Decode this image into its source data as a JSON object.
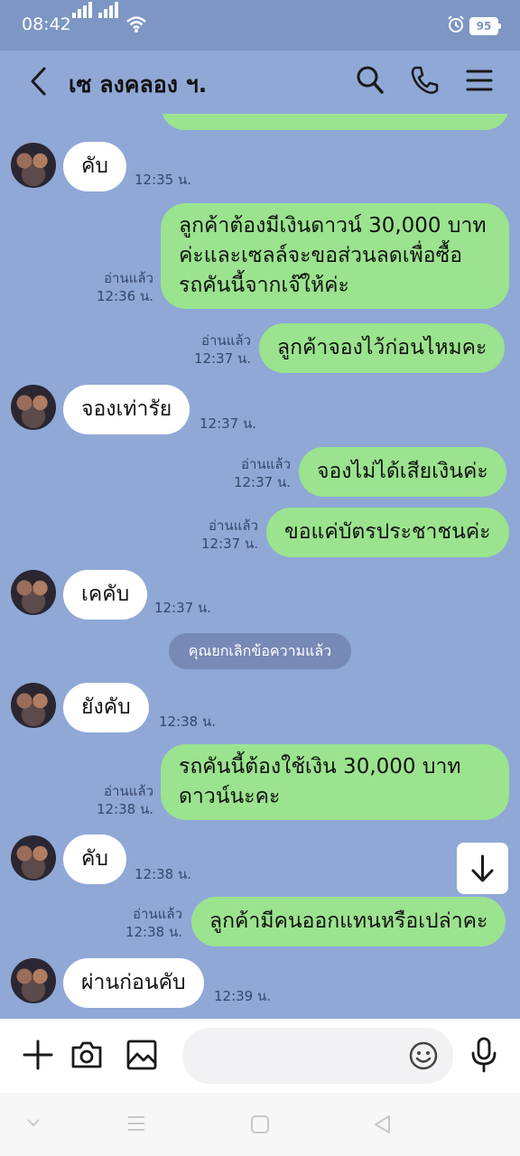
{
  "status": {
    "time": "08:42",
    "battery": "95"
  },
  "header": {
    "title": "เซ ลงคลอง ฯ."
  },
  "messages": [
    {
      "id": "m1",
      "text": "คับ",
      "time": "12:35 น."
    },
    {
      "id": "m2",
      "lines": [
        "ลูกค้าต้องมีเงินดาวน์ 30,000 บาท",
        "ค่ะและเซลล์จะขอส่วนลดเพื่อซื้อ",
        "รถคันนี้จากเจ๊ให้ค่ะ"
      ],
      "read": "อ่านแล้ว",
      "time": "12:36 น."
    },
    {
      "id": "m3",
      "text": "ลูกค้าจองไว้ก่อนไหมคะ",
      "read": "อ่านแล้ว",
      "time": "12:37 น."
    },
    {
      "id": "m4",
      "text": "จองเท่ารัย",
      "time": "12:37 น."
    },
    {
      "id": "m5",
      "text": "จองไม่ได้เสียเงินค่ะ",
      "read": "อ่านแล้ว",
      "time": "12:37 น."
    },
    {
      "id": "m6",
      "text": "ขอแค่บัตรประชาชนค่ะ",
      "read": "อ่านแล้ว",
      "time": "12:37 น."
    },
    {
      "id": "m7",
      "text": "เคคับ",
      "time": "12:37 น."
    },
    {
      "id": "m8",
      "text": "ยังคับ",
      "time": "12:38 น."
    },
    {
      "id": "m9",
      "lines": [
        "รถคันนี้ต้องใช้เงิน 30,000 บาท",
        "ดาวน์นะคะ"
      ],
      "read": "อ่านแล้ว",
      "time": "12:38 น."
    },
    {
      "id": "m10",
      "text": "คับ",
      "time": "12:38 น."
    },
    {
      "id": "m11",
      "text": "ลูกค้ามีคนออกแทนหรือเปล่าคะ",
      "read": "อ่านแล้ว",
      "time": "12:38 น."
    },
    {
      "id": "m12",
      "text": "ผ่านก่อนคับ",
      "time": "12:39 น."
    }
  ],
  "system_notice": "คุณยกเลิกข้อความแล้ว",
  "composer": {
    "placeholder": ""
  },
  "icons": [
    "back-icon",
    "search-icon",
    "phone-icon",
    "menu-icon",
    "plus-icon",
    "camera-icon",
    "image-icon",
    "emoji-icon",
    "mic-icon",
    "arrow-down-icon"
  ],
  "colors": {
    "background": "#8fa8d6",
    "outgoing_bubble": "#9be38e",
    "incoming_bubble": "#ffffff"
  }
}
